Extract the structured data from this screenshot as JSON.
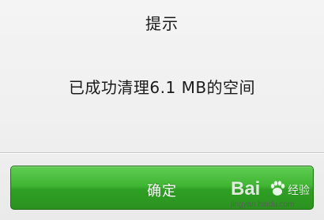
{
  "dialog": {
    "title": "提示",
    "message": "已成功清理6.1 MB的空间",
    "confirm_label": "确定"
  },
  "watermark": {
    "brand": "Bai",
    "brand_tail": "经验",
    "url": "jingyan.baidu.com",
    "icon": "baidu-paw-icon"
  },
  "colors": {
    "dialog_bg": "#efefef",
    "button_green": "#41b534",
    "button_text": "#ffffff"
  }
}
